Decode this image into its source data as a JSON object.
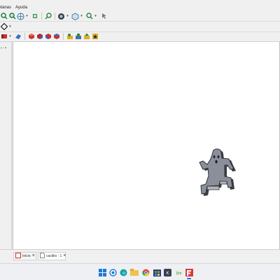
{
  "menubar": {
    "items": [
      "ntanas",
      "Ayuda"
    ]
  },
  "toolbar": {
    "row1": [
      "zoom-fit-icon",
      "zoom-selection-icon",
      "std-view-icon",
      "draw-style-icon",
      "zoom-magnifier-icon",
      "link-icon",
      "cube-view-icon",
      "measure-icon",
      "pointer-icon"
    ],
    "row2": [
      "part-diamond-icon"
    ],
    "row3": [
      "red-solid-icon",
      "blue-shape-icon",
      "red-cube-icon",
      "red-box2-icon",
      "red-box3-icon",
      "blue-box-icon",
      "yellow-gear-icon",
      "green-tool-icon",
      "yellow-tool-icon",
      "yellow-star-icon"
    ]
  },
  "tabs": [
    {
      "label": "Inicio"
    },
    {
      "label": "cactilio : 1"
    }
  ],
  "taskbar": {
    "icons": [
      "windows-start-icon",
      "search-icon",
      "edge-icon",
      "file-explorer-icon",
      "chrome-icon",
      "store-icon",
      "mail-icon",
      "terminal-icon",
      "freecad-icon",
      "snip-icon"
    ]
  },
  "colors": {
    "accent": "#2a6fd6",
    "viewport_bg": "#ffffff",
    "model_fill": "#8a8f9a"
  }
}
